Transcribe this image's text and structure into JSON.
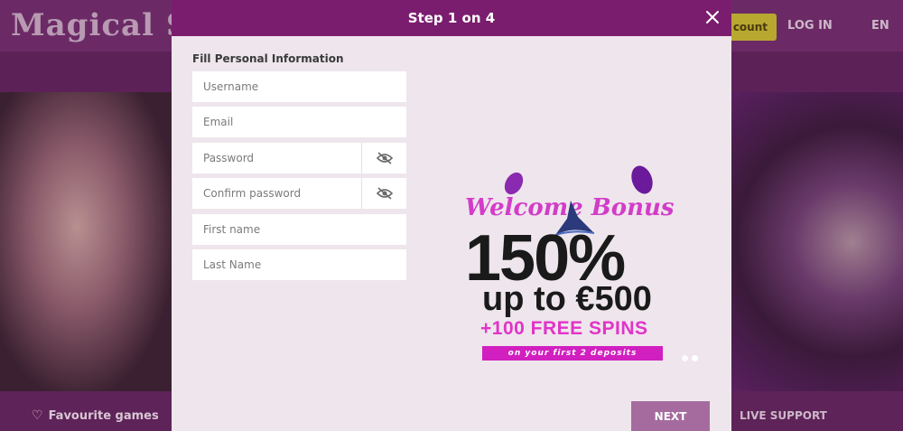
{
  "site": {
    "logo": "Magical Spi",
    "account_label": "count",
    "login_label": "LOG IN",
    "language": "EN",
    "favourite_label": "Favourite games",
    "live_support_label": "LIVE SUPPORT"
  },
  "modal": {
    "title": "Step 1 on 4",
    "section_title": "Fill Personal Information",
    "fields": {
      "username": {
        "placeholder": "Username",
        "value": ""
      },
      "email": {
        "placeholder": "Email",
        "value": ""
      },
      "password": {
        "placeholder": "Password",
        "value": ""
      },
      "confirm_password": {
        "placeholder": "Confirm password",
        "value": ""
      },
      "first_name": {
        "placeholder": "First name",
        "value": ""
      },
      "last_name": {
        "placeholder": "Last Name",
        "value": ""
      }
    },
    "next_label": "NEXT",
    "close_icon": "close-icon",
    "eye_icon": "eye-off-icon"
  },
  "promo": {
    "title_part1": "Welco",
    "title_part2": "me Bonus",
    "percent": "150%",
    "up_to": "up to €500",
    "free_spins": "+100 FREE SPINS",
    "deposits": "on your first 2 deposits"
  },
  "colors": {
    "header": "#7b1d6e",
    "next_button": "#a56b9f",
    "modal_bg": "#eee6ec"
  }
}
